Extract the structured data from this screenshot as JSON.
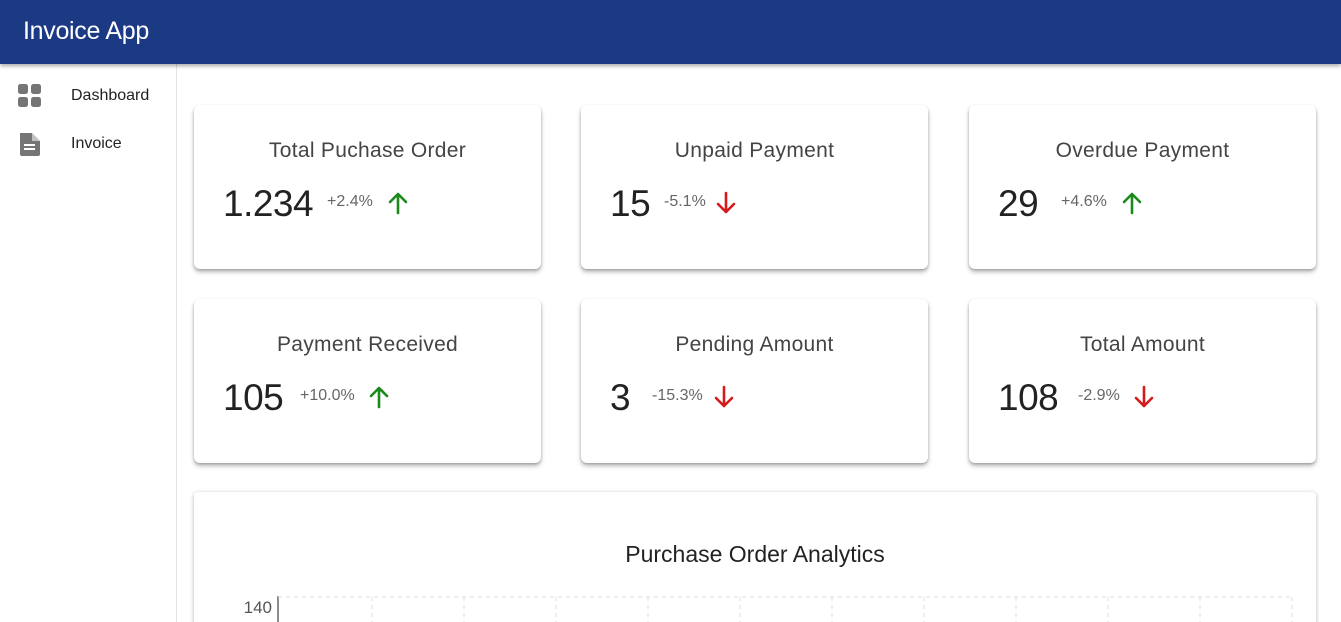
{
  "app": {
    "title": "Invoice App"
  },
  "sidebar": {
    "items": [
      {
        "label": "Dashboard",
        "icon": "dashboard-icon"
      },
      {
        "label": "Invoice",
        "icon": "document-icon"
      }
    ]
  },
  "colors": {
    "appbar": "#1c3a84",
    "up": "#1a8a1a",
    "down": "#d41a1a"
  },
  "cards": [
    {
      "title": "Total Puchase Order",
      "value": "1.234",
      "change": "+2.4%",
      "trend": "up"
    },
    {
      "title": "Unpaid Payment",
      "value": "15",
      "change": "-5.1%",
      "trend": "down"
    },
    {
      "title": "Overdue Payment",
      "value": "29",
      "change": "+4.6%",
      "trend": "up"
    },
    {
      "title": "Payment Received",
      "value": "105",
      "change": "+10.0%",
      "trend": "up"
    },
    {
      "title": "Pending Amount",
      "value": "3",
      "change": "-15.3%",
      "trend": "down"
    },
    {
      "title": "Total Amount",
      "value": "108",
      "change": "-2.9%",
      "trend": "down"
    }
  ],
  "chart": {
    "title": "Purchase Order Analytics",
    "y_tick_top": "140"
  }
}
